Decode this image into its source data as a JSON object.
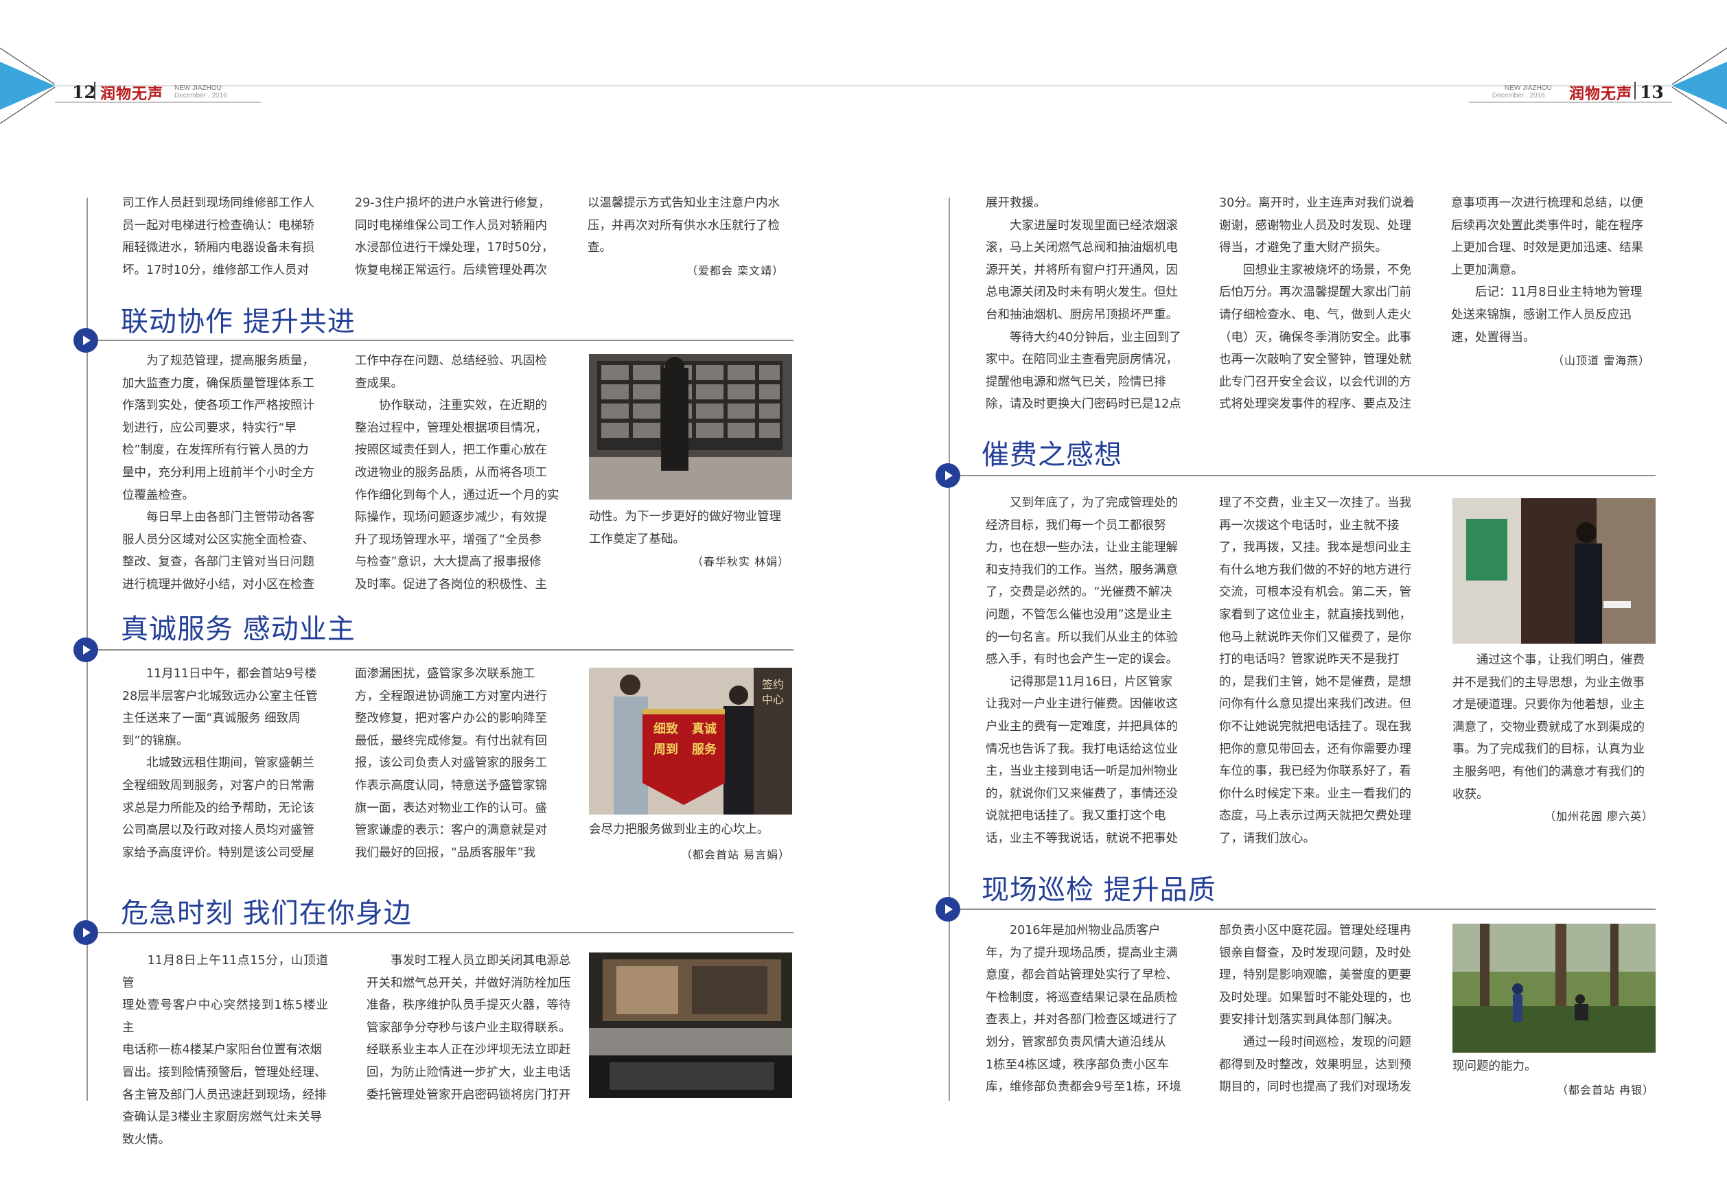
{
  "header": {
    "left_page_number": "12",
    "right_page_number": "13",
    "brand_name": "润物无声",
    "magazine_name": "NEW JIAZHOU",
    "issue_date": "December , 2016",
    "accent_color": "#3aa6dc",
    "brand_color": "#b8191c"
  },
  "heading_color": "#233f97",
  "intro": {
    "col1": "司工作人员赶到现场同维修部工作人\n员一起对电梯进行检查确认：电梯轿\n厢轻微进水，轿厢内电器设备未有损\n坏。17时10分，维修部工作人员对",
    "col2": "29-3住户损坏的进户水管进行修复，\n同时电梯维保公司工作人员对轿厢内\n水浸部位进行干燥处理，17时50分，\n恢复电梯正常运行。后续管理处再次",
    "col3": "以温馨提示方式告知业主注意户内水\n压，并再次对所有供水水压就行了检\n查。",
    "signature": "（爱都会  栾文靖）"
  },
  "sections": [
    {
      "title": "联动协作  提升共进",
      "col1": "　　为了规范管理，提高服务质量，\n加大监查力度，确保质量管理体系工\n作落到实处，使各项工作严格按照计\n划进行，应公司要求，特实行“早\n检”制度，在发挥所有行管人员的力\n量中，充分利用上班前半个小时全方\n位覆盖检查。\n　　每日早上由各部门主管带动各客\n服人员分区域对公区实施全面检查、\n整改、复查，各部门主管对当日问题\n进行梳理并做好小结，对小区在检查",
      "col2": "工作中存在问题、总结经验、巩固检\n查成果。\n　　协作联动，注重实效，在近期的\n整治过程中，管理处根据项目情况，\n按照区域责任到人，把工作重心放在\n改进物业的服务品质，从而将各项工\n作作细化到每个人，通过近一个月的实\n际操作，现场问题逐步减少，有效提\n升了现场管理水平，增强了“全员参\n与检查”意识，大大提高了报事报修\n及时率。促进了各岗位的积极性、主",
      "col3": "动性。为下一步更好的做好物业管理\n工作奠定了基础。",
      "signature": "（春华秋实  林娟）"
    },
    {
      "title": "真诚服务  感动业主",
      "col1": "　　11月11日中午，都会首站9号楼\n28层半层客户北城致远办公室主任管\n主任送来了一面“真诚服务 细致周\n到”的锦旗。\n　　北城致远租住期间，管家盛朝兰\n全程细致周到服务，对客户的日常需\n求总是力所能及的给予帮助，无论该\n公司高层以及行政对接人员均对盛管\n家给予高度评价。特别是该公司受屋",
      "col2": "面渗漏困扰，盛管家多次联系施工\n方，全程跟进协调施工方对室内进行\n整改修复，把对客户办公的影响降至\n最低，最终完成修复。有付出就有回\n报，该公司负责人对盛管家的服务工\n作表示高度认同，特意送予盛管家锦\n旗一面，表达对物业工作的认可。盛\n管家谦虚的表示：客户的满意就是对\n我们最好的回报，“品质客服年”我",
      "col3": "会尽力把服务做到业主的心坎上。",
      "signature": "（都会首站  易言娟）",
      "banner_text": [
        "真诚服务",
        "细致周到"
      ]
    },
    {
      "title": "危急时刻  我们在你身边",
      "col1": "　　11月8日上午11点15分，山顶道管\n理处壹号客户中心突然接到1栋5楼业主\n电话称一栋4楼某户家阳台位置有浓烟\n冒出。接到险情预警后，管理处经理、\n各主管及部门人员迅速赶到现场，经排\n查确认是3楼业主家厨房燃气灶未关导\n致火情。",
      "col2": "　　事发时工程人员立即关闭其电源总\n开关和燃气总开关，并做好消防栓加压\n准备，秩序维护队员手提灭火器，等待\n管家部争分夺秒与该户业主取得联系。\n经联系业主本人正在沙坪坝无法立即赶\n回，为防止险情进一步扩大，业主电话\n委托管理处管家开启密码锁将房门打开"
    }
  ],
  "right_intro": {
    "col1": "展开救援。\n　　大家进屋时发现里面已经浓烟滚\n滚，马上关闭燃气总阀和抽油烟机电\n源开关，并将所有窗户打开通风，因\n总电源关闭及时未有明火发生。但灶\n台和抽油烟机、厨房吊顶损坏严重。\n　　等待大约40分钟后，业主回到了\n家中。在陪同业主查看完厨房情况，\n提醒他电源和燃气已关，险情已排\n除，请及时更换大门密码时已是12点",
    "col2": "30分。离开时，业主连声对我们说着\n谢谢，感谢物业人员及时发现、处理\n得当，才避免了重大财产损失。\n　　回想业主家被烧坏的场景，不免\n后怕万分。再次温馨提醒大家出门前\n请仔细检查水、电、气，做到人走火\n（电）灭，确保冬季消防安全。此事\n也再一次敲响了安全警钟，管理处就\n此专门召开安全会议，以会代训的方\n式将处理突发事件的程序、要点及注",
    "col3": "意事项再一次进行梳理和总结，以便\n后续再次处置此类事件时，能在程序\n上更加合理、时效是更加迅速、结果\n上更加满意。\n　　后记：11月8日业主特地为管理\n处送来锦旗，感谢工作人员反应迅\n速，处置得当。",
    "signature": "（山顶道  雷海燕）"
  },
  "right_sections": [
    {
      "title": "催费之感想",
      "col1": "　　又到年底了，为了完成管理处的\n经济目标，我们每一个员工都很努\n力，也在想一些办法，让业主能理解\n和支持我们的工作。当然，服务满意\n了，交费是必然的。“光催费不解决\n问题，不管怎么催也没用”这是业主\n的一句名言。所以我们从业主的体验\n感入手，有时也会产生一定的误会。\n　　记得那是11月16日，片区管家\n让我对一户业主进行催费。因催收这\n户业主的费有一定难度，并把具体的\n情况也告诉了我。我打电话给这位业\n主，当业主接到电话一听是加州物业\n的，就说你们又来催费了，事情还没\n说就把电话挂了。我又重打这个电\n话，业主不等我说话，就说不把事处",
      "col2": "理了不交费，业主又一次挂了。当我\n再一次拨这个电话时，业主就不接\n了，我再拨，又挂。我本是想问业主\n有什么地方我们做的不好的地方进行\n交流，可根本没有机会。第二天，管\n家看到了这位业主，就直接找到他，\n他马上就说昨天你们又催费了，是你\n打的电话吗？管家说昨天不是我打\n的，是我们主管，她不是催费，是想\n问你有什么意见提出来我们改进。但\n你不让她说完就把电话挂了。现在我\n把你的意见带回去，还有你需要办理\n车位的事，我已经为你联系好了，看\n你什么时候定下来。业主一看我们的\n态度，马上表示过两天就把欠费处理\n了，请我们放心。",
      "col3": "　　通过这个事，让我们明白，催费\n并不是我们的主导思想，为业主做事\n才是硬道理。只要你为他着想，业主\n满意了，交物业费就成了水到渠成的\n事。为了完成我们的目标，认真为业\n主服务吧，有他们的满意才有我们的\n收获。",
      "signature": "（加州花园  廖六英）"
    },
    {
      "title": "现场巡检  提升品质",
      "col1": "　　2016年是加州物业品质客户\n年，为了提升现场品质，提高业主满\n意度，都会首站管理处实行了早检、\n午检制度，将巡查结果记录在品质检\n查表上，并对各部门检查区域进行了\n划分，管家部负责风情大道沿线从\n1栋至4栋区域，秩序部负责小区车\n库，维修部负责都会9号至1栋，环境",
      "col2": "部负责小区中庭花园。管理处经理冉\n银亲自督查，及时发现问题，及时处\n理，特别是影响观瞻，美誉度的更要\n及时处理。如果暂时不能处理的，也\n要安排计划落实到具体部门解决。\n　　通过一段时间巡检，发现的问题\n都得到及时整改，效果明显，达到预\n期目的，同时也提高了我们对现场发",
      "col3": "现问题的能力。",
      "signature": "（都会首站  冉银）"
    }
  ]
}
